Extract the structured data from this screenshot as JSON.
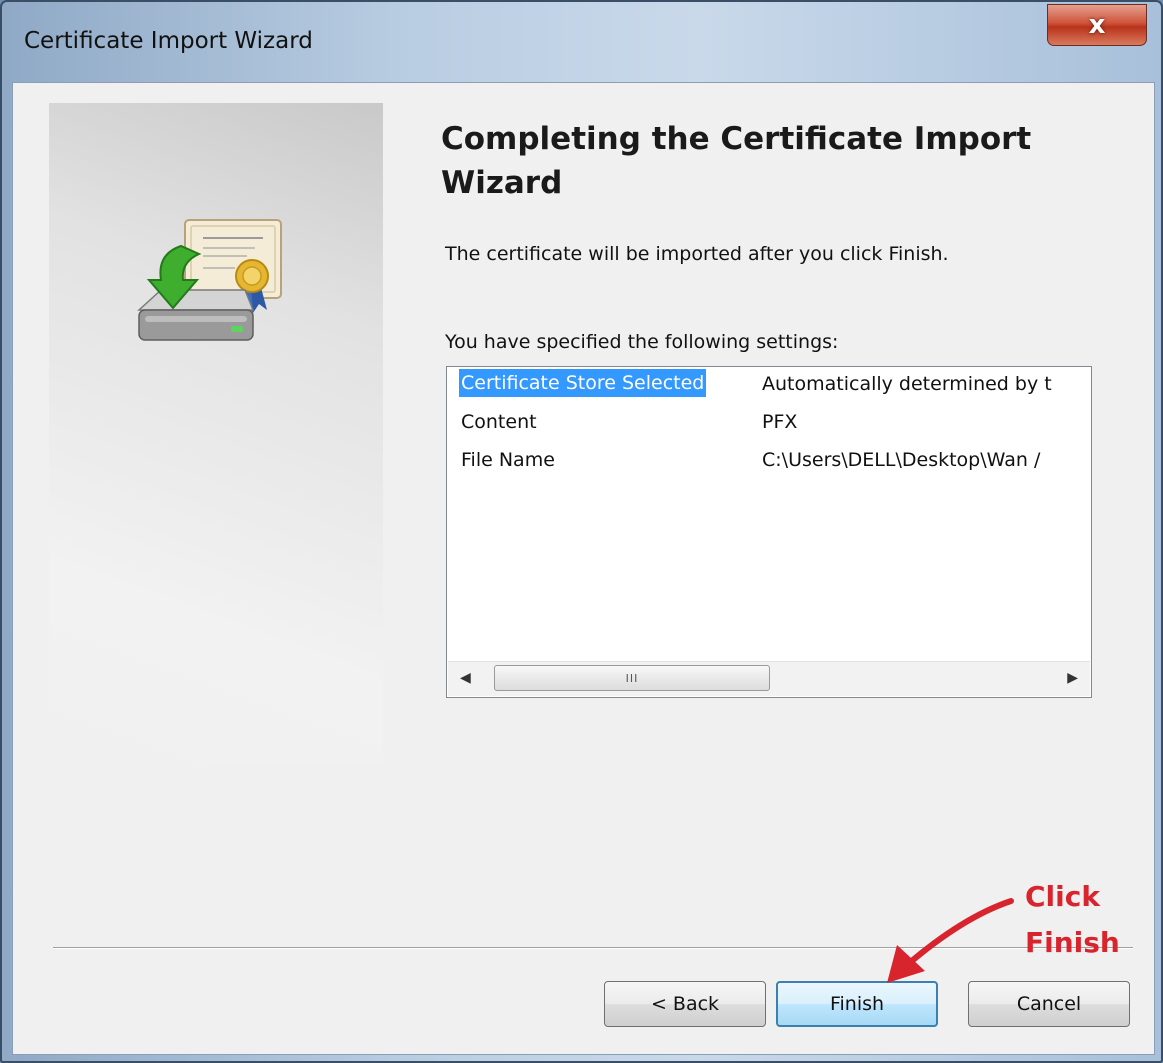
{
  "window": {
    "title": "Certificate Import Wizard",
    "close_label": "x"
  },
  "wizard": {
    "heading": "Completing the Certificate Import Wizard",
    "info": "The certificate will be imported after you click Finish.",
    "settings_label": "You have specified the following settings:",
    "settings": [
      {
        "name": "Certificate Store Selected",
        "value": "Automatically determined by t",
        "selected": true
      },
      {
        "name": "Content",
        "value": "PFX",
        "selected": false
      },
      {
        "name": "File Name",
        "value": "C:\\Users\\DELL\\Desktop\\Wan /",
        "selected": false
      }
    ],
    "scroll_thumb_grip": "III"
  },
  "buttons": {
    "back": "< Back",
    "finish": "Finish",
    "cancel": "Cancel"
  },
  "annotation": {
    "line1": "Click",
    "line2": "Finish",
    "color": "#d8242c"
  },
  "icons": {
    "wizard": "certificate-import-icon",
    "close": "close-icon",
    "scroll_left": "scroll-left-arrow-icon",
    "scroll_right": "scroll-right-arrow-icon",
    "annotation_arrow": "red-arrow-icon"
  }
}
